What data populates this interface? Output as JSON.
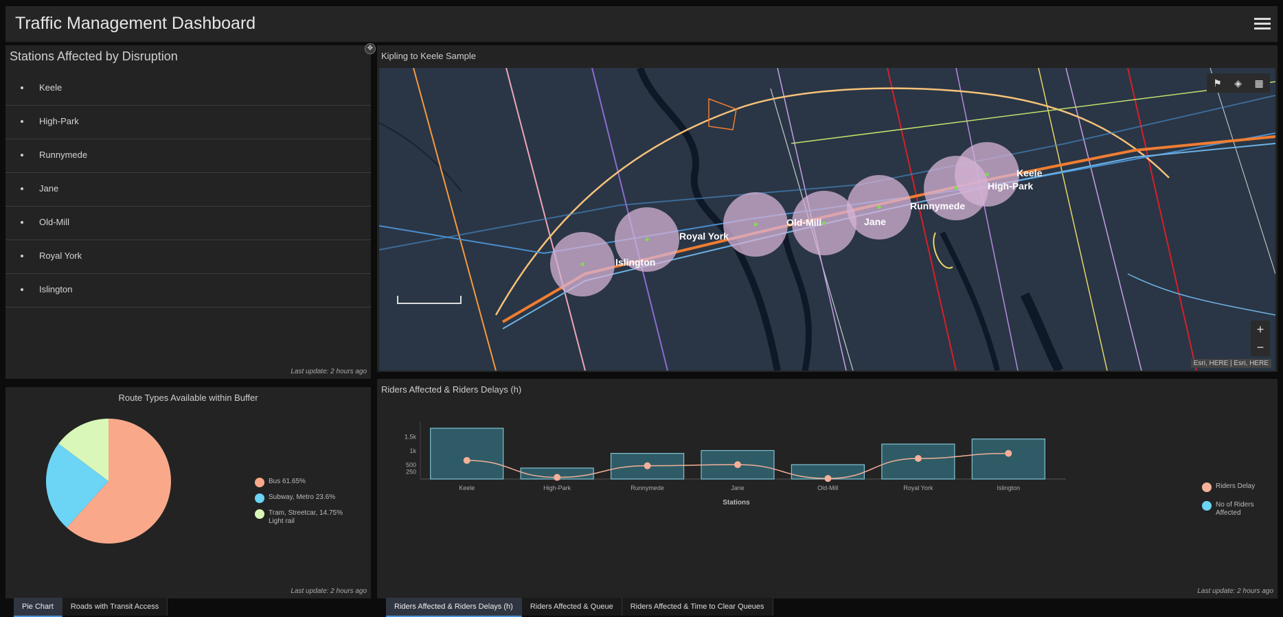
{
  "header": {
    "title": "Traffic Management Dashboard"
  },
  "stations_panel": {
    "title": "Stations Affected by Disruption",
    "items": [
      "Keele",
      "High-Park",
      "Runnymede",
      "Jane",
      "Old-Mill",
      "Royal York",
      "Islington"
    ],
    "last_update": "Last update: 2 hours ago"
  },
  "map_panel": {
    "title": "Kipling to Keele Sample",
    "attribution": "Esri, HERE | Esri, HERE",
    "zoom_in": "+",
    "zoom_out": "−",
    "tools": [
      "bookmark-icon",
      "layers-icon",
      "basemap-gallery-icon"
    ],
    "station_labels": [
      "Islington",
      "Royal York",
      "Old-Mill",
      "Jane",
      "Runnymede",
      "High-Park",
      "Keele"
    ]
  },
  "pie_panel": {
    "title": "Route Types Available within Buffer",
    "last_update": "Last update: 2 hours ago",
    "legend": [
      "Bus 61.65%",
      "Subway, Metro 23.6%",
      "Tram, Streetcar, 14.75%",
      "Light rail"
    ]
  },
  "bar_panel": {
    "title": "Riders Affected & Riders Delays (h)",
    "xlabel": "Stations",
    "last_update": "Last update: 2 hours ago",
    "legend": [
      "Riders Delay",
      "No of Riders",
      "Affected"
    ]
  },
  "left_tabs": [
    "Pie Chart",
    "Roads with Transit Access"
  ],
  "right_tabs": [
    "Riders Affected & Riders Delays (h)",
    "Riders Affected & Queue",
    "Riders Affected & Time to Clear Queues"
  ],
  "colors": {
    "bus": "#f9a98a",
    "subway": "#6cd4f5",
    "tram": "#d9f7b8",
    "bar": "#2f5b66",
    "bar_border": "#7fc4d4",
    "line": "#f4b09a"
  },
  "chart_data": [
    {
      "type": "pie",
      "title": "Route Types Available within Buffer",
      "categories": [
        "Bus",
        "Subway, Metro",
        "Tram, Streetcar, Light rail"
      ],
      "values": [
        61.65,
        23.6,
        14.75
      ]
    },
    {
      "type": "bar",
      "title": "Riders Affected & Riders Delays (h)",
      "xlabel": "Stations",
      "ylabel": "",
      "categories": [
        "Keele",
        "High-Park",
        "Runnymede",
        "Jane",
        "Old-Mill",
        "Royal York",
        "Islington"
      ],
      "y_ticks": [
        "250",
        "500",
        "1k",
        "1.5k"
      ],
      "series": [
        {
          "name": "No of Riders Affected",
          "type": "bar",
          "values": [
            1800,
            390,
            910,
            1010,
            510,
            1240,
            1420
          ]
        },
        {
          "name": "Riders Delay",
          "type": "line",
          "values": [
            660,
            60,
            470,
            510,
            20,
            730,
            910
          ]
        }
      ]
    }
  ]
}
